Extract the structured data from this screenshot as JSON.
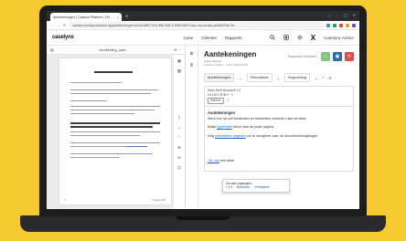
{
  "browser": {
    "tab_title": "Aantekeningen | Caselyn Platform | Dit ...",
    "tab_close": "×",
    "new_tab": "+",
    "window_controls": [
      "⌄",
      "–",
      "▢",
      "✕"
    ],
    "back": "←",
    "forward": "→",
    "reload": "⟳",
    "url": "caselynx.tool/app/caselynx.app/aantekeningen/ec20d1daf87-b21f-4f5d-9e5f-47e69f22db05-aep-cont-kreuka-ca4d9c2f2bc7eb",
    "ext_colors": [
      "#3b82f6",
      "#16a34a",
      "#ef4444",
      "#f59e0b",
      "#7c3aed"
    ]
  },
  "app": {
    "logo": "caselynx",
    "nav": [
      "Case",
      "Cliënten",
      "Rapports"
    ],
    "user": "Caselynx Admin",
    "icons": [
      "search-icon",
      "grid-icon",
      "gear-icon"
    ]
  },
  "doc": {
    "title": "handleiding_parti...",
    "page_left": "1",
    "page_right": "1 pagina 200"
  },
  "notes": {
    "title": "Aantekeningen",
    "meta_line1": "Laatst bewerkt",
    "meta_line2": "Caselynx Admin · 24-07-2023 08:29",
    "status": "Document verwerkt",
    "tabs": [
      "Aantekeningen",
      "Plekvakkies",
      "Dagvoeding"
    ],
    "toolbar_row1": "Sans Serif   Normal   B I U",
    "toolbar_row2": "H1 H2  ≡  ☰  ⊞  ⇤  ⇥",
    "edit_button": "Edit box",
    "heading": "Aantekeningen",
    "para1": "Werk met uw pdf bestanden en teksteditor verbindt u aan de tekst.",
    "para2_pre": "Maak ",
    "para2_link": "hyperlinks",
    "para2_post": " direct naar de juiste pagina.",
    "para3_pre": "Volg ",
    "para3_link": "interactieve pagina's",
    "para3_post": " om te navigeren naar de documentverwijzingen.",
    "para4_link": "Tip: ook",
    "para4_post": " een tabel.",
    "popup_label": "Ga naar paginagina:",
    "popup_pages": "1   2   3",
    "popup_action1": "Bewerken",
    "popup_action2": "Verwijderen"
  }
}
